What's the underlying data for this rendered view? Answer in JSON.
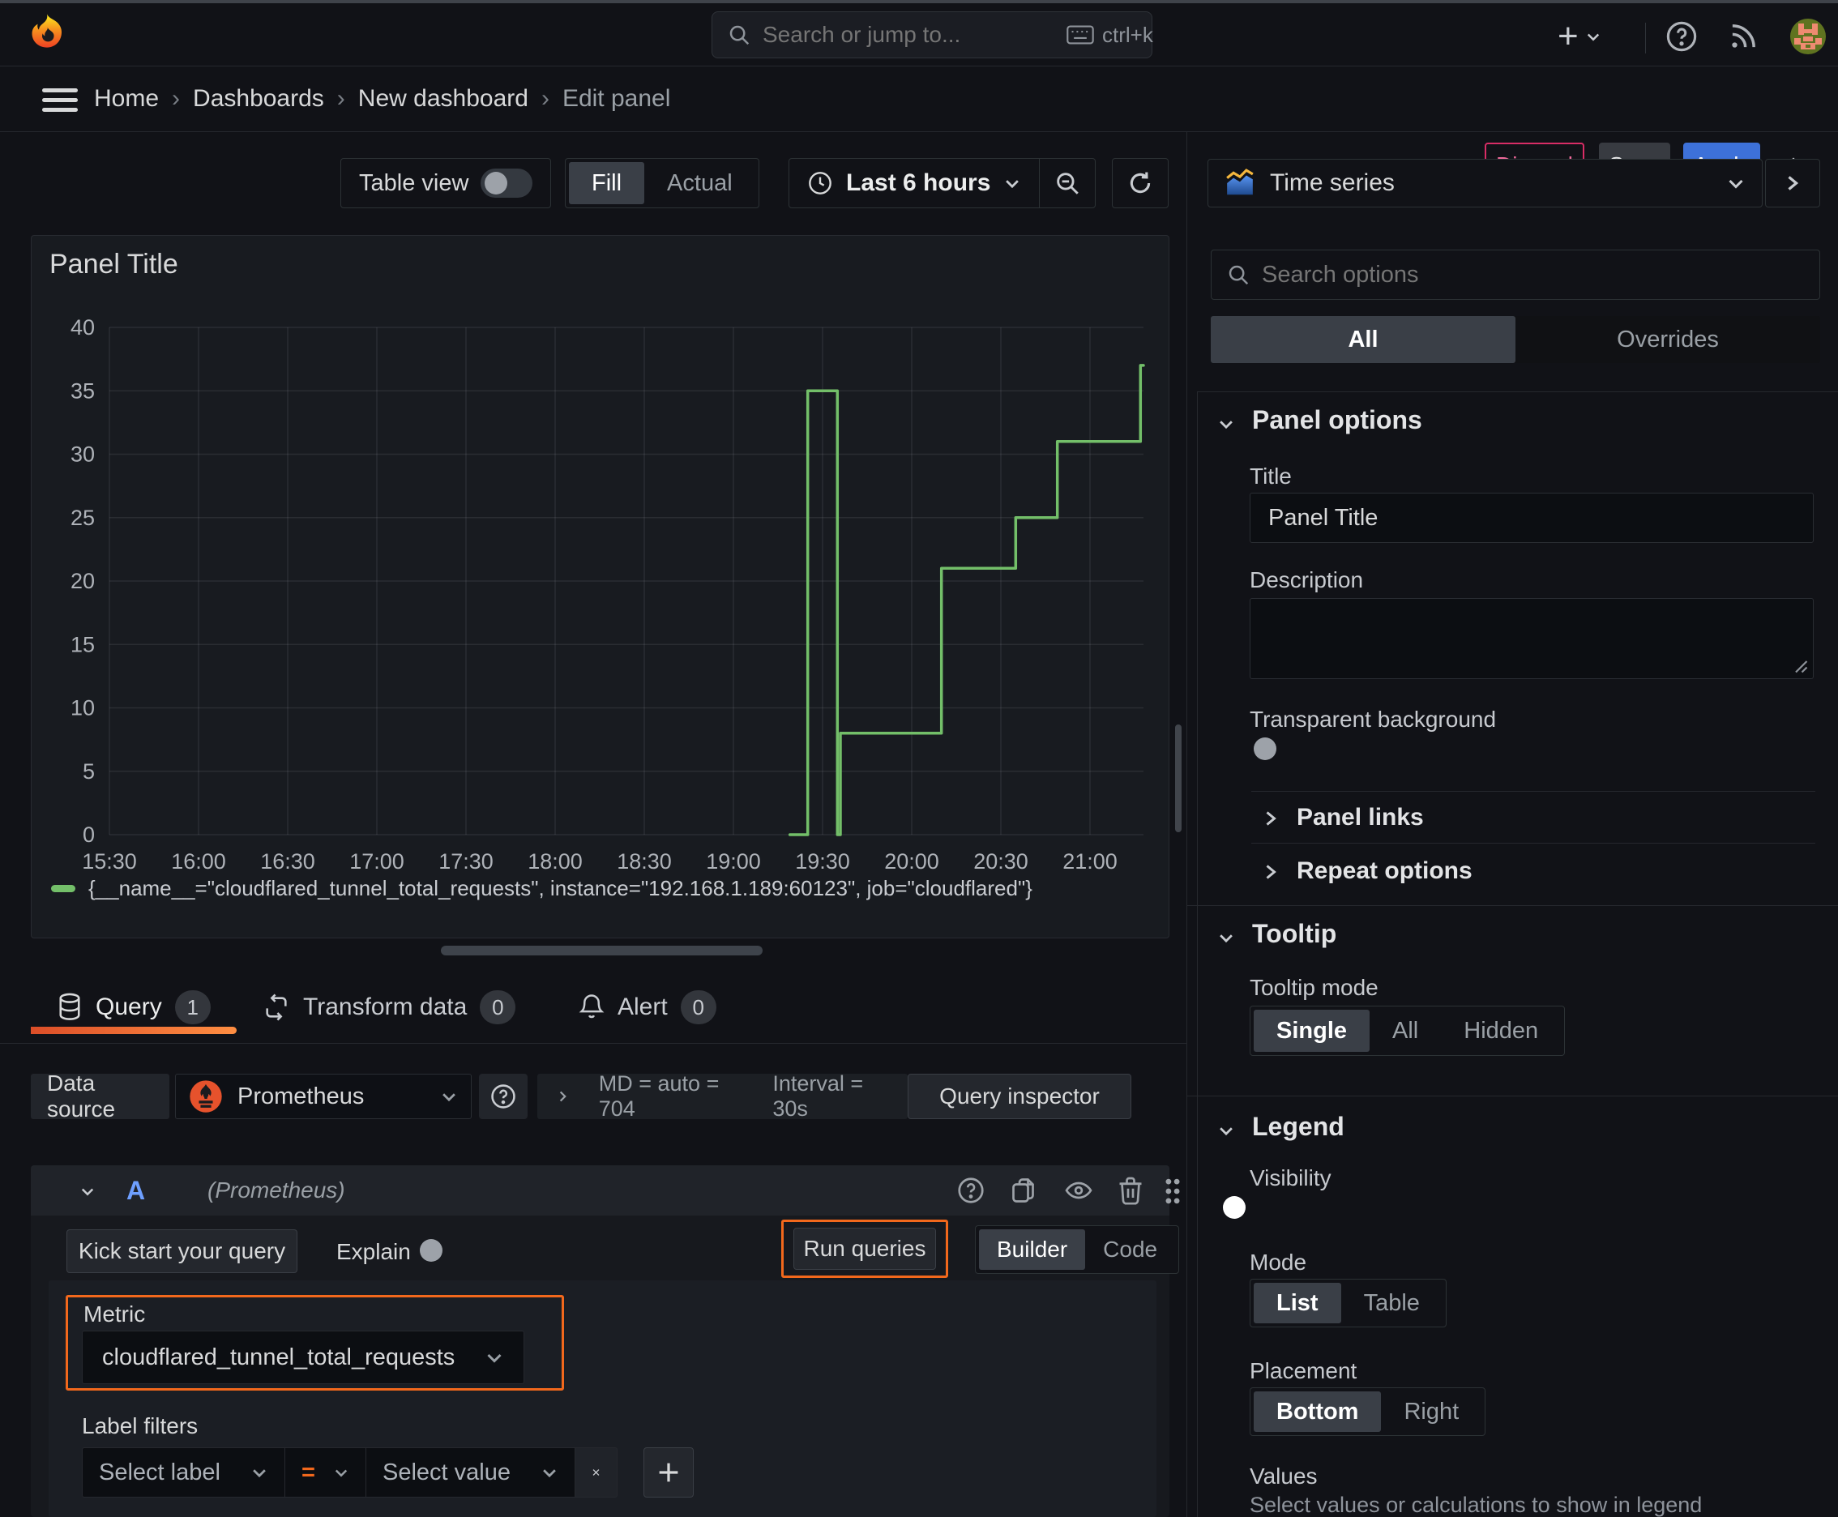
{
  "topbar": {
    "search_placeholder": "Search or jump to...",
    "search_shortcut": "ctrl+k"
  },
  "breadcrumb": {
    "items": [
      "Home",
      "Dashboards",
      "New dashboard",
      "Edit panel"
    ],
    "separator": "›"
  },
  "header_actions": {
    "discard": "Discard",
    "save": "Save",
    "apply": "Apply"
  },
  "toolbar": {
    "table_view_label": "Table view",
    "fill": "Fill",
    "actual": "Actual",
    "time_range": "Last 6 hours"
  },
  "panel": {
    "title": "Panel Title"
  },
  "chart_data": {
    "type": "line",
    "title": "Panel Title",
    "step": "after",
    "grid": true,
    "legend_position": "bottom",
    "xlabel": "",
    "ylabel": "",
    "ylim": [
      0,
      40
    ],
    "y_ticks": [
      0,
      5,
      10,
      15,
      20,
      25,
      30,
      35,
      40
    ],
    "x_ticks": [
      "15:30",
      "16:00",
      "16:30",
      "17:00",
      "17:30",
      "18:00",
      "18:30",
      "19:00",
      "19:30",
      "20:00",
      "20:30",
      "21:00"
    ],
    "x_start": "15:30",
    "x_end": "21:18",
    "series": [
      {
        "name": "{__name__=\"cloudflared_tunnel_total_requests\", instance=\"192.168.1.189:60123\", job=\"cloudflared\"}",
        "color": "#73BF69",
        "points": [
          [
            "19:19",
            0
          ],
          [
            "19:25",
            35
          ],
          [
            "19:35",
            0
          ],
          [
            "19:36",
            8
          ],
          [
            "20:10",
            21
          ],
          [
            "20:35",
            25
          ],
          [
            "20:49",
            31
          ],
          [
            "21:17",
            37
          ],
          [
            "21:18",
            37
          ]
        ]
      }
    ]
  },
  "tabs": {
    "query": "Query",
    "query_count": "1",
    "transform": "Transform data",
    "transform_count": "0",
    "alert": "Alert",
    "alert_count": "0"
  },
  "datasource_row": {
    "label": "Data source",
    "value": "Prometheus",
    "stats": "MD = auto = 704",
    "interval": "Interval = 30s",
    "inspector": "Query inspector"
  },
  "query_row": {
    "ref_id": "A",
    "datasource_hint": "(Prometheus)"
  },
  "query_toolbar": {
    "kickstart": "Kick start your query",
    "explain": "Explain",
    "run": "Run queries",
    "builder": "Builder",
    "code": "Code"
  },
  "metric_section": {
    "label": "Metric",
    "value": "cloudflared_tunnel_total_requests"
  },
  "label_filters": {
    "label": "Label filters",
    "select_label": "Select label",
    "operator": "=",
    "select_value": "Select value"
  },
  "sidebar": {
    "viz_name": "Time series",
    "search_placeholder": "Search options",
    "tabs": {
      "all": "All",
      "overrides": "Overrides"
    },
    "panel_options": {
      "title": "Panel options",
      "title_label": "Title",
      "title_value": "Panel Title",
      "description_label": "Description",
      "transparent_label": "Transparent background"
    },
    "collapsed": {
      "panel_links": "Panel links",
      "repeat_options": "Repeat options"
    },
    "tooltip": {
      "title": "Tooltip",
      "mode_label": "Tooltip mode",
      "options": [
        "Single",
        "All",
        "Hidden"
      ]
    },
    "legend": {
      "title": "Legend",
      "visibility_label": "Visibility",
      "mode_label": "Mode",
      "mode_options": [
        "List",
        "Table"
      ],
      "placement_label": "Placement",
      "placement_options": [
        "Bottom",
        "Right"
      ],
      "values_label": "Values",
      "values_help": "Select values or calculations to show in legend"
    }
  },
  "colors": {
    "accent_orange": "#f2681c",
    "accent_blue": "#3d71d9",
    "series_green": "#73BF69",
    "discard_pink": "#d92d66",
    "background": "#111217",
    "panel_bg": "#181b20"
  }
}
